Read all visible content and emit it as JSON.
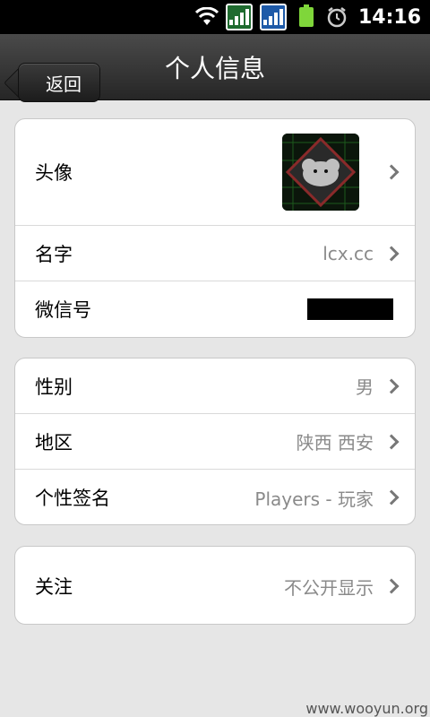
{
  "status_bar": {
    "time": "14:16",
    "icons": [
      "wifi-icon",
      "signal-icon",
      "signal-icon",
      "battery-icon",
      "alarm-icon"
    ],
    "colors": {
      "signal_1": "#1f6b2f",
      "signal_2": "#1e5aa8",
      "battery": "#7fd63a"
    }
  },
  "nav": {
    "back_label": "返回",
    "title": "个人信息"
  },
  "group1": [
    {
      "label": "头像",
      "value": "",
      "type": "avatar"
    },
    {
      "label": "名字",
      "value": "lcx.cc"
    },
    {
      "label": "微信号",
      "value": "",
      "type": "redacted"
    }
  ],
  "group2": [
    {
      "label": "性别",
      "value": "男"
    },
    {
      "label": "地区",
      "value": "陕西 西安"
    },
    {
      "label": "个性签名",
      "value": "Players - 玩家"
    }
  ],
  "group3": [
    {
      "label": "关注",
      "value": "不公开显示"
    }
  ],
  "watermark": "www.wooyun.org"
}
